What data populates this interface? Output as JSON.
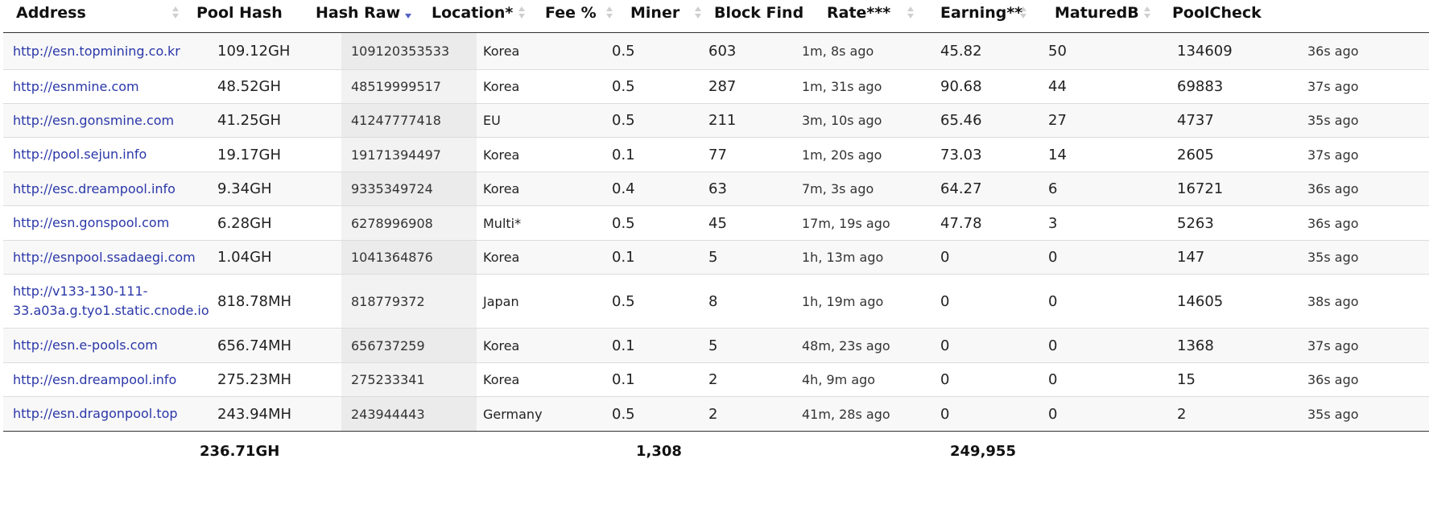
{
  "columns": [
    {
      "key": "address",
      "label": "Address",
      "sortable": true,
      "sort": "none"
    },
    {
      "key": "pool_hash",
      "label": "Pool Hash",
      "sortable": false,
      "sort": "none"
    },
    {
      "key": "hash_raw",
      "label": "Hash Raw",
      "sortable": true,
      "sort": "descending"
    },
    {
      "key": "location",
      "label": "Location*",
      "sortable": true,
      "sort": "none"
    },
    {
      "key": "fee",
      "label": "Fee %",
      "sortable": true,
      "sort": "none"
    },
    {
      "key": "miner",
      "label": "Miner",
      "sortable": true,
      "sort": "none"
    },
    {
      "key": "block_find",
      "label": "Block Find",
      "sortable": false,
      "sort": "none"
    },
    {
      "key": "rate",
      "label": "Rate***",
      "sortable": true,
      "sort": "none"
    },
    {
      "key": "earning",
      "label": "Earning**",
      "sortable": true,
      "sort": "none"
    },
    {
      "key": "matured",
      "label": "MaturedB",
      "sortable": true,
      "sort": "none"
    },
    {
      "key": "poolcheck",
      "label": "PoolCheck",
      "sortable": false,
      "sort": "none"
    }
  ],
  "rows": [
    {
      "address": "http://esn.topmining.co.kr",
      "pool_hash": "109.12GH",
      "hash_raw": "109120353533",
      "location": "Korea",
      "fee": "0.5",
      "miner": "603",
      "block_find": "1m, 8s ago",
      "rate": "45.82",
      "earning": "50",
      "matured": "134609",
      "poolcheck": "36s ago"
    },
    {
      "address": "http://esnmine.com",
      "pool_hash": "48.52GH",
      "hash_raw": "48519999517",
      "location": "Korea",
      "fee": "0.5",
      "miner": "287",
      "block_find": "1m, 31s ago",
      "rate": "90.68",
      "earning": "44",
      "matured": "69883",
      "poolcheck": "37s ago"
    },
    {
      "address": "http://esn.gonsmine.com",
      "pool_hash": "41.25GH",
      "hash_raw": "41247777418",
      "location": "EU",
      "fee": "0.5",
      "miner": "211",
      "block_find": "3m, 10s ago",
      "rate": "65.46",
      "earning": "27",
      "matured": "4737",
      "poolcheck": "35s ago"
    },
    {
      "address": "http://pool.sejun.info",
      "pool_hash": "19.17GH",
      "hash_raw": "19171394497",
      "location": "Korea",
      "fee": "0.1",
      "miner": "77",
      "block_find": "1m, 20s ago",
      "rate": "73.03",
      "earning": "14",
      "matured": "2605",
      "poolcheck": "37s ago"
    },
    {
      "address": "http://esc.dreampool.info",
      "pool_hash": "9.34GH",
      "hash_raw": "9335349724",
      "location": "Korea",
      "fee": "0.4",
      "miner": "63",
      "block_find": "7m, 3s ago",
      "rate": "64.27",
      "earning": "6",
      "matured": "16721",
      "poolcheck": "36s ago"
    },
    {
      "address": "http://esn.gonspool.com",
      "pool_hash": "6.28GH",
      "hash_raw": "6278996908",
      "location": "Multi*",
      "fee": "0.5",
      "miner": "45",
      "block_find": "17m, 19s ago",
      "rate": "47.78",
      "earning": "3",
      "matured": "5263",
      "poolcheck": "36s ago"
    },
    {
      "address": "http://esnpool.ssadaegi.com",
      "pool_hash": "1.04GH",
      "hash_raw": "1041364876",
      "location": "Korea",
      "fee": "0.1",
      "miner": "5",
      "block_find": "1h, 13m ago",
      "rate": "0",
      "earning": "0",
      "matured": "147",
      "poolcheck": "35s ago"
    },
    {
      "address": "http://v133-130-111-33.a03a.g.tyo1.static.cnode.io",
      "pool_hash": "818.78MH",
      "hash_raw": "818779372",
      "location": "Japan",
      "fee": "0.5",
      "miner": "8",
      "block_find": "1h, 19m ago",
      "rate": "0",
      "earning": "0",
      "matured": "14605",
      "poolcheck": "38s ago"
    },
    {
      "address": "http://esn.e-pools.com",
      "pool_hash": "656.74MH",
      "hash_raw": "656737259",
      "location": "Korea",
      "fee": "0.1",
      "miner": "5",
      "block_find": "48m, 23s ago",
      "rate": "0",
      "earning": "0",
      "matured": "1368",
      "poolcheck": "37s ago"
    },
    {
      "address": "http://esn.dreampool.info",
      "pool_hash": "275.23MH",
      "hash_raw": "275233341",
      "location": "Korea",
      "fee": "0.1",
      "miner": "2",
      "block_find": "4h, 9m ago",
      "rate": "0",
      "earning": "0",
      "matured": "15",
      "poolcheck": "36s ago"
    },
    {
      "address": "http://esn.dragonpool.top",
      "pool_hash": "243.94MH",
      "hash_raw": "243944443",
      "location": "Germany",
      "fee": "0.5",
      "miner": "2",
      "block_find": "41m, 28s ago",
      "rate": "0",
      "earning": "0",
      "matured": "2",
      "poolcheck": "35s ago"
    }
  ],
  "totals": {
    "pool_hash": "236.71GH",
    "miner": "1,308",
    "earning": "249,955"
  },
  "colors": {
    "link": "#2a37a8",
    "sort_active": "#5561c4",
    "sort_idle": "#cfcfcf"
  },
  "icons": {
    "sort_indicator": "sort-arrows-icon"
  }
}
